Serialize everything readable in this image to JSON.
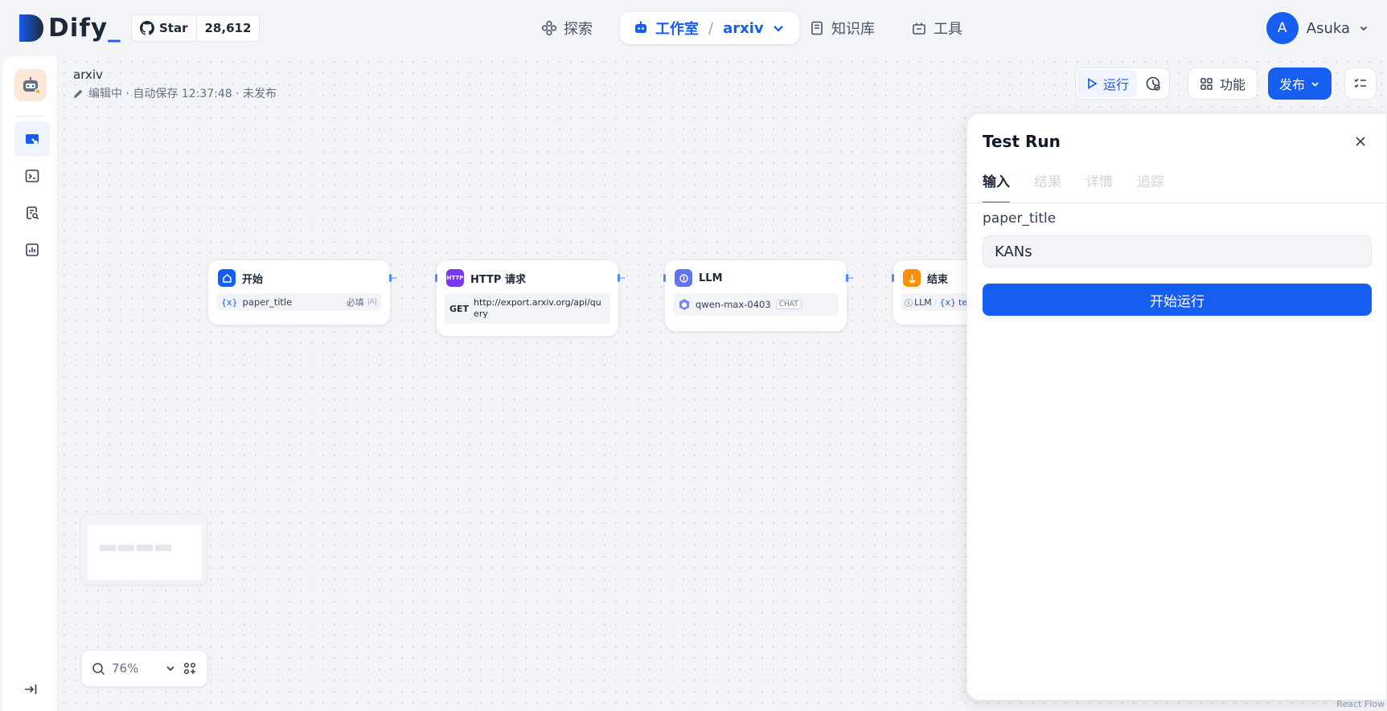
{
  "topbar": {
    "logo_text": "Dify",
    "logo_suffix": "_",
    "github": {
      "star_label": "Star",
      "star_count": "28,612"
    },
    "nav": {
      "explore": "探索",
      "studio": "工作室",
      "studio_app": "arxiv",
      "knowledge": "知识库",
      "tools": "工具"
    },
    "user": {
      "initial": "A",
      "name": "Asuka"
    }
  },
  "app": {
    "name": "arxiv",
    "status": "编辑中 · 自动保存 12:37:48 · 未发布"
  },
  "toolbar": {
    "run_label": "运行",
    "features_label": "功能",
    "publish_label": "发布"
  },
  "nodes": {
    "start": {
      "title": "开始",
      "var": "paper_title",
      "required": "必填"
    },
    "http": {
      "title": "HTTP 请求",
      "icon_text": "HTTP",
      "method": "GET",
      "url": "http://export.arxiv.org/api/query"
    },
    "llm": {
      "title": "LLM",
      "model": "qwen-max-0403",
      "mode": "CHAT"
    },
    "end": {
      "title": "结束",
      "source": "LLM",
      "var": "text"
    }
  },
  "zoom": {
    "level": "76%"
  },
  "panel": {
    "title": "Test Run",
    "tabs": [
      "输入",
      "结果",
      "详情",
      "追踪"
    ],
    "field_label": "paper_title",
    "field_value": "KANs",
    "start_button": "开始运行"
  },
  "watermark": "React Flow",
  "colors": {
    "accent": "#155eef",
    "http": "#7839ee",
    "llm": "#6172f3",
    "end": "#f79009"
  }
}
